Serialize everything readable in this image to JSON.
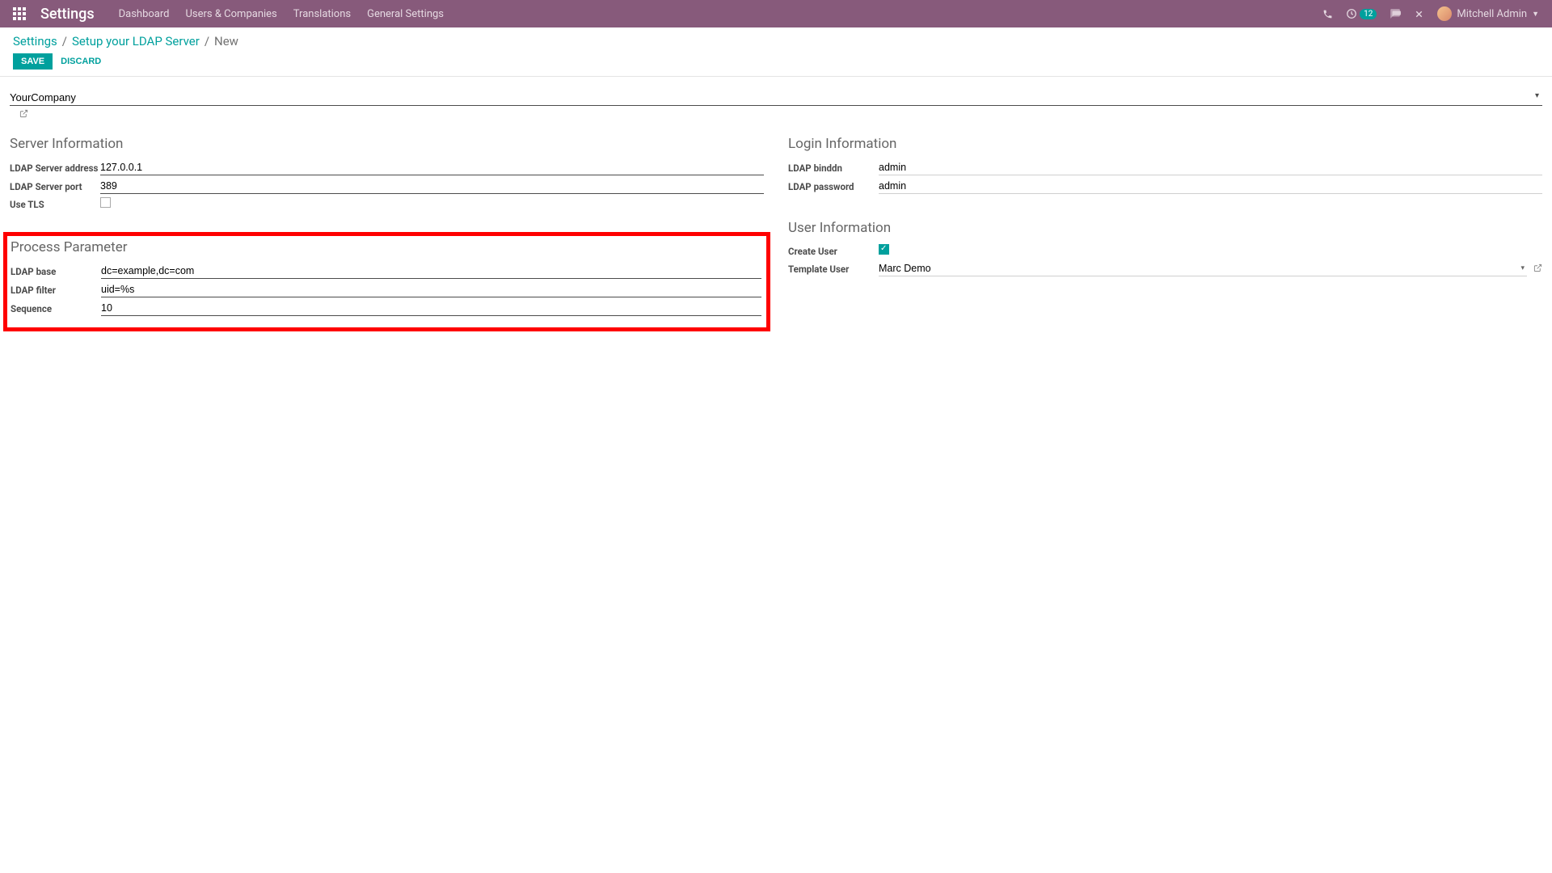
{
  "navbar": {
    "title": "Settings",
    "links": [
      "Dashboard",
      "Users & Companies",
      "Translations",
      "General Settings"
    ],
    "activity_count": "12",
    "user_name": "Mitchell Admin"
  },
  "breadcrumb": {
    "items": [
      "Settings",
      "Setup your LDAP Server"
    ],
    "current": "New"
  },
  "buttons": {
    "save": "SAVE",
    "discard": "DISCARD"
  },
  "form": {
    "company": "YourCompany",
    "server_info": {
      "title": "Server Information",
      "address_label": "LDAP Server address",
      "address_value": "127.0.0.1",
      "port_label": "LDAP Server port",
      "port_value": "389",
      "tls_label": "Use TLS",
      "tls_checked": false
    },
    "login_info": {
      "title": "Login Information",
      "binddn_label": "LDAP binddn",
      "binddn_value": "admin",
      "password_label": "LDAP password",
      "password_value": "admin"
    },
    "process_param": {
      "title": "Process Parameter",
      "base_label": "LDAP base",
      "base_value": "dc=example,dc=com",
      "filter_label": "LDAP filter",
      "filter_value": "uid=%s",
      "sequence_label": "Sequence",
      "sequence_value": "10"
    },
    "user_info": {
      "title": "User Information",
      "create_user_label": "Create User",
      "create_user_checked": true,
      "template_user_label": "Template User",
      "template_user_value": "Marc Demo"
    }
  }
}
